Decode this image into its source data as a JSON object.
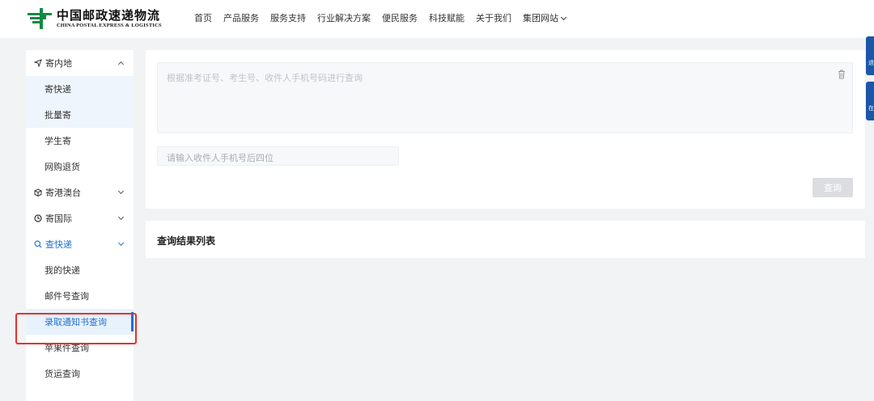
{
  "brand": {
    "name_cn": "中国邮政速递物流",
    "name_en": "CHINA POSTAL EXPRESS & LOGISTICS",
    "color": "#118a45"
  },
  "nav": {
    "items": [
      "首页",
      "产品服务",
      "服务支持",
      "行业解决方案",
      "便民服务",
      "科技赋能",
      "关于我们"
    ],
    "group_site": "集团网站"
  },
  "sidebar": {
    "accent": "#1f6fd1",
    "groups": [
      {
        "label": "寄内地",
        "icon": "send-icon",
        "items": [
          "寄快递",
          "批量寄",
          "学生寄",
          "网购退货"
        ]
      },
      {
        "label": "寄港澳台",
        "icon": "box-icon"
      },
      {
        "label": "寄国际",
        "icon": "globe-icon"
      },
      {
        "label": "查快递",
        "icon": "search-icon",
        "items": [
          "我的快递",
          "邮件号查询",
          "录取通知书查询",
          "苹果件查询",
          "货运查询"
        ]
      }
    ]
  },
  "form": {
    "textarea_placeholder": "根据准考证号、考生号、收件人手机号码进行查询",
    "phone_placeholder": "请输入收件人手机号后四位",
    "query_button": "查询"
  },
  "results": {
    "title": "查询结果列表"
  },
  "float_tabs": [
    "退",
    "在"
  ]
}
